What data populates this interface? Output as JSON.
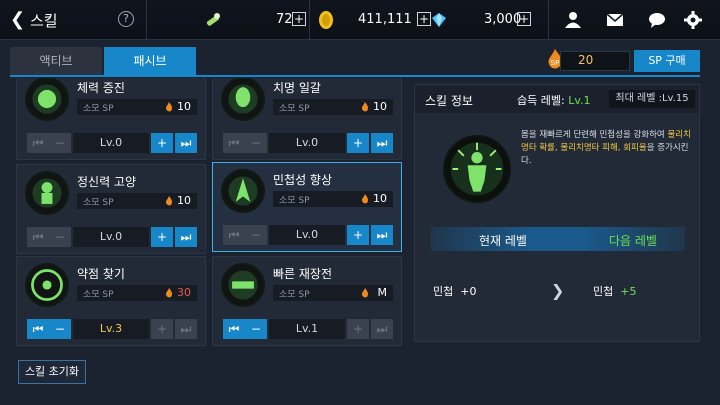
{
  "header": {
    "back": "❮",
    "title": "스킬",
    "help": "?",
    "stamina": "72",
    "gold": "411,111",
    "gems": "3,000",
    "plus": "+"
  },
  "tabs": [
    {
      "label": "액티브",
      "active": false
    },
    {
      "label": "패시브",
      "active": true
    }
  ],
  "sp": {
    "label": "SP",
    "value": "20",
    "buy_label": "SP 구매"
  },
  "cost_label": "소모 SP",
  "skills": [
    {
      "name": "체력 증진",
      "cost": "10",
      "level": "Lv.0"
    },
    {
      "name": "치명 일갈",
      "cost": "10",
      "level": "Lv.0"
    },
    {
      "name": "정신력 고양",
      "cost": "10",
      "level": "Lv.0"
    },
    {
      "name": "민첩성 향상",
      "cost": "10",
      "level": "Lv.0"
    },
    {
      "name": "약점 찾기",
      "cost": "30",
      "level": "Lv.3"
    },
    {
      "name": "빠른 재장전",
      "cost": "M",
      "level": "Lv.1"
    }
  ],
  "buttons": {
    "first": "⏮",
    "minus": "−",
    "plus": "+",
    "last": "⏭"
  },
  "reset_label": "스킬 초기화",
  "info": {
    "title": "스킬 정보",
    "acquired_label": "습득 레벨:",
    "acquired_value": "Lv.1",
    "max_level": "최대 레벨 :Lv.15",
    "desc_1": "몸을 재빠르게 단련해 민첩성을 강화하여 ",
    "desc_hl": "물리치명타 확률, 물리치명타 피해, 회피율",
    "desc_2": "을 증가시킨다.",
    "current_label": "현재 레벨",
    "next_label": "다음 레벨",
    "stat_name": "민첩",
    "current_value": "+0",
    "next_value": "+5"
  },
  "colors": {
    "accent": "#1787c9",
    "green": "#6fe04f",
    "gold": "#f1c843",
    "red": "#e35a4b"
  }
}
